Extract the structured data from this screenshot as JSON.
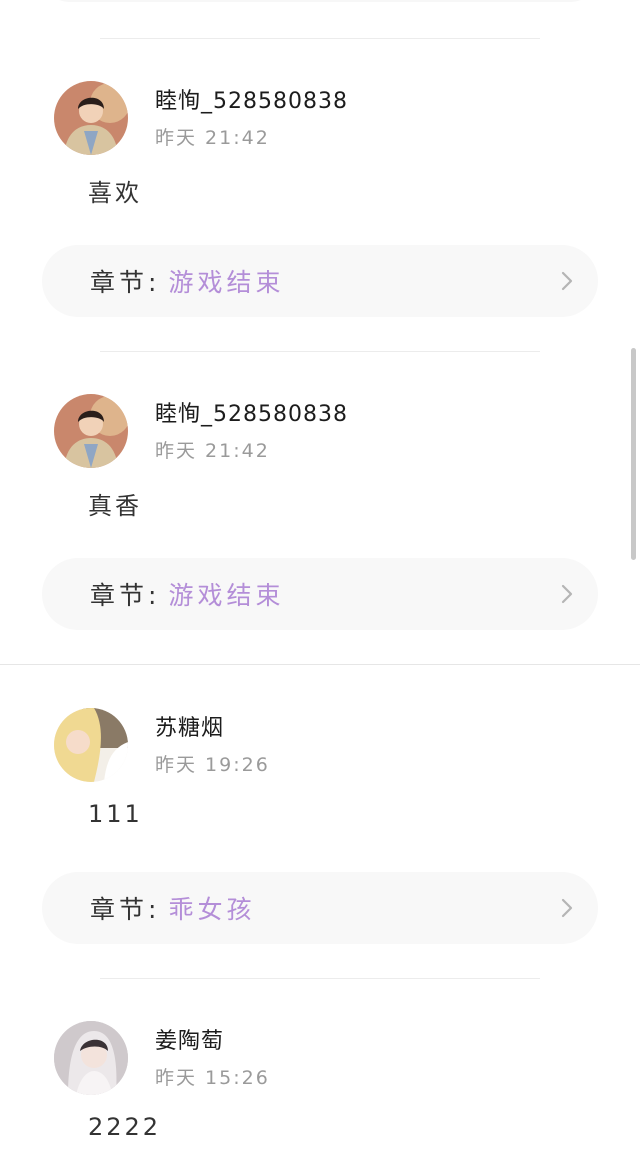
{
  "comments": [
    {
      "username": "睦恂_528580838",
      "time": "昨天 21:42",
      "text": "喜欢",
      "avatar_icon": "user-photo-avatar",
      "chapter_prefix": "章节:",
      "chapter_name": "游戏结束"
    },
    {
      "username": "睦恂_528580838",
      "time": "昨天 21:42",
      "text": "真香",
      "avatar_icon": "user-photo-avatar",
      "chapter_prefix": "章节:",
      "chapter_name": "游戏结束"
    },
    {
      "username": "苏糖烟",
      "time": "昨天 19:26",
      "text": "111",
      "avatar_icon": "user-photo-avatar",
      "chapter_prefix": "章节:",
      "chapter_name": "乖女孩"
    },
    {
      "username": "姜陶萄",
      "time": "昨天 15:26",
      "text": "2222",
      "avatar_icon": "user-photo-avatar"
    }
  ],
  "colors": {
    "chapter_name": "#b48ed8",
    "chapter_bg": "#f8f8f8",
    "time_text": "#9a9a9a",
    "divider": "#ececec"
  },
  "icons": {
    "chapter_arrow": "chevron-right-icon"
  }
}
